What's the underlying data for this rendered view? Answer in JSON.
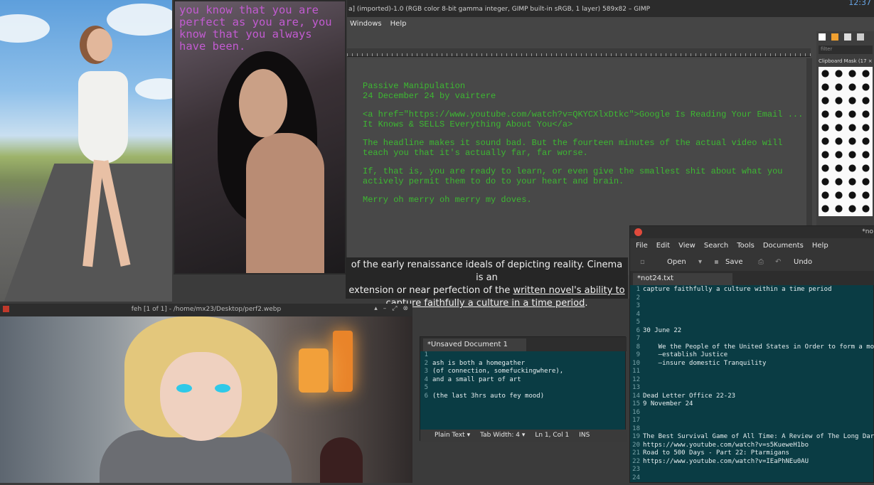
{
  "photo_quote": "you know that you are perfect as you are, you know that you always have been.",
  "gimp": {
    "title": "a] (imported)-1.0 (RGB color 8-bit gamma integer, GIMP built-in sRGB, 1 layer) 589x82 – GIMP",
    "clock": "12:37",
    "menu": [
      "Windows",
      "Help"
    ],
    "dock_filter": "filter",
    "dock_title": "Clipboard Mask (17 ×",
    "text_lines": [
      "Passive Manipulation",
      "24 December 24 by vairtere",
      "<a href=\"https://www.youtube.com/watch?v=QKYCXlxDtkc\">Google Is Reading Your Email ... It Knows & SELLS Everything About You</a>",
      "The headline makes it sound bad. But the fourteen minutes of the actual video will teach you that it's actually far, far worse.",
      "If, that is, you are ready to learn, or even give the smallest shit about what you actively permit them to do to your heart and brain.",
      "Merry oh merry oh merry my doves."
    ]
  },
  "subtitle": {
    "line1": "of the early renaissance ideals of depicting reality. Cinema is an",
    "line2a": "extension or near perfection of the ",
    "line2b": "written novel's ability to",
    "line3": "capture faithfully a culture in a time period",
    "line3end": "."
  },
  "feh": {
    "title": "feh [1 of 1] - /home/mx23/Desktop/perf2.webp",
    "buttons": [
      "▴",
      "–",
      "⤢",
      "⊗"
    ]
  },
  "gedit1": {
    "tab": "*Unsaved Document 1",
    "line_numbers": "1\n2\n3\n4\n5\n6",
    "text": "\nash is both a homegather\n(of connection, somefuckingwhere),\nand a small part of art\n\n(the last 3hrs auto fey mood)",
    "status": [
      "Plain Text ▾",
      "Tab Width: 4 ▾",
      "Ln 1, Col 1",
      "INS"
    ]
  },
  "gedit2": {
    "title": "*no",
    "menu": [
      "File",
      "Edit",
      "View",
      "Search",
      "Tools",
      "Documents",
      "Help"
    ],
    "toolbar": {
      "open": "Open",
      "save": "Save",
      "undo": "Undo"
    },
    "tab": "*not24.txt",
    "line_numbers": "1\n2\n3\n4\n5\n6\n7\n8\n9\n10\n11\n12\n13\n14\n15\n16\n17\n18\n19\n20\n21\n22\n23\n24",
    "text": "capture faithfully a culture within a time period\n\n\n\n\n30 June 22\n\n    We the People of the United States in Order to form a more\n    —establish Justice\n    —insure domestic Tranquility\n\n\n\nDead Letter Office 22-23\n9 November 24\n\n\n\nThe Best Survival Game of All Time: A Review of The Long Dark\nhttps://www.youtube.com/watch?v=s5KueweH1bo\nRoad to 500 Days - Part 22: Ptarmigans\nhttps://www.youtube.com/watch?v=IEaPhNEu0AU\n\n"
  }
}
